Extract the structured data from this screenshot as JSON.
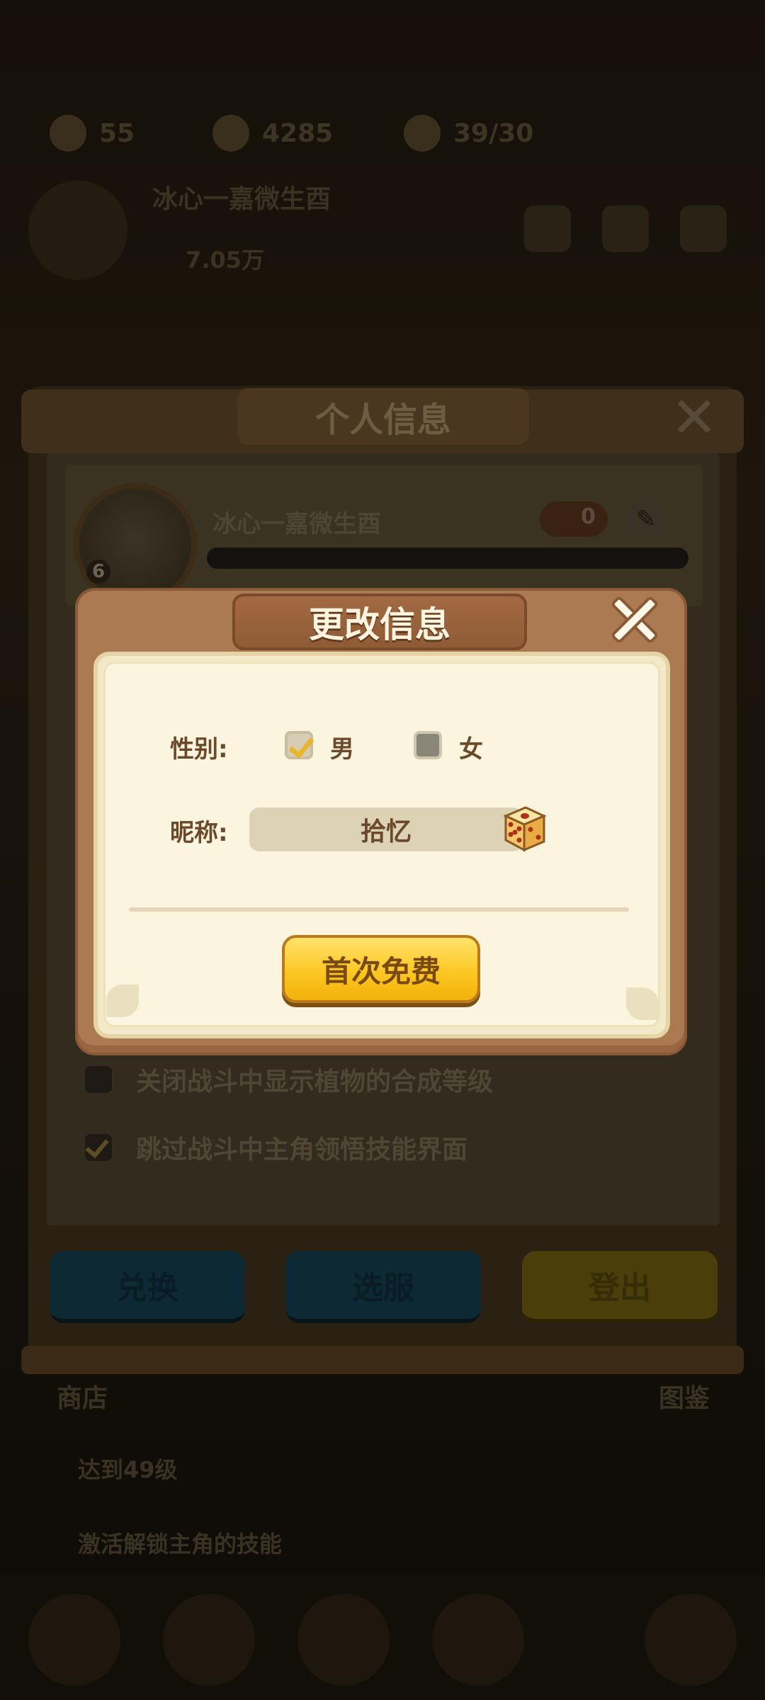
{
  "background": {
    "resources": [
      {
        "icon": "energy-icon",
        "value": "55"
      },
      {
        "icon": "coin-icon",
        "value": "4285"
      },
      {
        "icon": "stamina-icon",
        "value": "39/30"
      }
    ],
    "player_name": "冰心一嘉微生酉",
    "player_power": "7.05万",
    "top_icons": [
      "mail-icon",
      "gift-icon",
      "settings-icon"
    ],
    "bottom_labels": [
      "商店",
      "图鉴"
    ],
    "mini_rows": [
      "达到49级",
      "激活解锁主角的技能"
    ]
  },
  "info_panel": {
    "title": "个人信息",
    "profile": {
      "name": "冰心一嘉微生酉",
      "level": "6",
      "likes": "0"
    },
    "options": [
      {
        "label": "关闭战斗中显示植物的合成等级",
        "checked": false
      },
      {
        "label": "跳过战斗中主角领悟技能界面",
        "checked": true
      }
    ],
    "buttons": {
      "redeem": "兑换",
      "server": "选服",
      "logout": "登出"
    }
  },
  "dialog": {
    "title": "更改信息",
    "gender_label": "性别:",
    "male_label": "男",
    "female_label": "女",
    "male_checked": true,
    "female_checked": false,
    "nickname_label": "昵称:",
    "nickname_value": "拾忆",
    "confirm_button": "首次免费"
  },
  "colors": {
    "dialog_frame": "#ab7a52",
    "dialog_paper": "#fbf5df",
    "button_yellow": "#fcc51f",
    "text_brown": "#6b4a2c"
  }
}
